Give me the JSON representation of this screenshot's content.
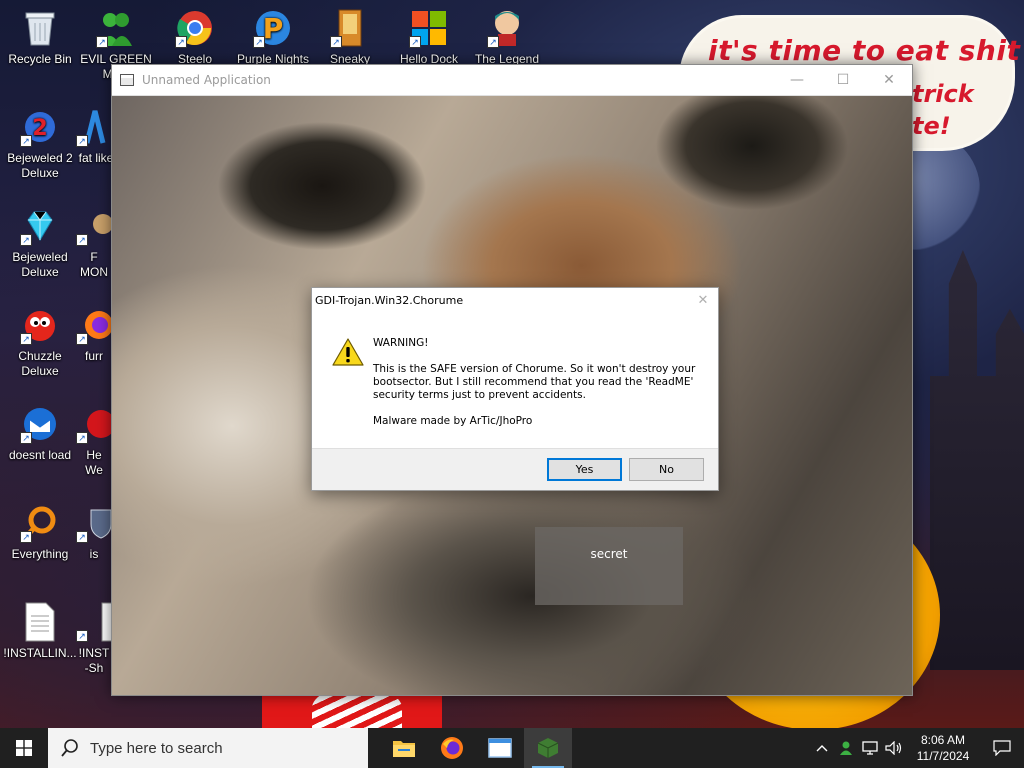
{
  "wallpaper": {
    "sign_line1": "it's time to eat shit",
    "sign_line2": "trick",
    "sign_line3": "te!"
  },
  "desktop_icons": [
    {
      "id": "recycle-bin",
      "label": "Recycle Bin",
      "icon": "recycle-bin-icon"
    },
    {
      "id": "evil-green",
      "label": "EVIL GREEN MEN",
      "icon": "green-men-icon"
    },
    {
      "id": "chrome",
      "label": "Steelo",
      "icon": "chrome-icon"
    },
    {
      "id": "purple-nights",
      "label": "Purple Nights",
      "icon": "p-logo-icon"
    },
    {
      "id": "sneaky",
      "label": "Sneaky",
      "icon": "game-icon"
    },
    {
      "id": "hello-dock",
      "label": "Hello Dock",
      "icon": "windows-logo-icon"
    },
    {
      "id": "the-legend",
      "label": "The Legend",
      "icon": "character-icon"
    },
    {
      "id": "bejeweled2",
      "label": "Bejeweled 2 Deluxe",
      "icon": "bejeweled2-icon"
    },
    {
      "id": "fat-like",
      "label": "fat like",
      "icon": "blue-figure-icon"
    },
    {
      "id": "bejeweled",
      "label": "Bejeweled Deluxe",
      "icon": "diamond-icon"
    },
    {
      "id": "fmon",
      "label": "F MON",
      "icon": "cartoon-icon"
    },
    {
      "id": "chuzzle",
      "label": "Chuzzle Deluxe",
      "icon": "chuzzle-icon"
    },
    {
      "id": "furr",
      "label": "furr",
      "icon": "firefox-icon"
    },
    {
      "id": "doesnt-load",
      "label": "doesnt load",
      "icon": "thunderbird-icon"
    },
    {
      "id": "he-we",
      "label": "He We",
      "icon": "red-ball-icon"
    },
    {
      "id": "everything",
      "label": "Everything",
      "icon": "search-ring-icon"
    },
    {
      "id": "is",
      "label": "is",
      "icon": "shield-icon"
    },
    {
      "id": "installing",
      "label": "!INSTALLIN...",
      "icon": "text-file-icon"
    },
    {
      "id": "installing2",
      "label": "!INST -Sh",
      "icon": "text-file-icon"
    }
  ],
  "app_window": {
    "title": "Unnamed Application",
    "minimize_glyph": "—",
    "maximize_glyph": "☐",
    "close_glyph": "✕",
    "secret_label": "secret"
  },
  "dialog": {
    "title": "GDI-Trojan.Win32.Chorume",
    "close_glyph": "✕",
    "line1": "WARNING!",
    "line2": "This is the SAFE version of Chorume. So it won't destroy your bootsector. But I still recommend that you read the 'ReadME' security terms just to prevent accidents.",
    "line3": "Malware made by ArTic/JhoPro",
    "yes_label": "Yes",
    "no_label": "No",
    "icon": "warning-icon"
  },
  "taskbar": {
    "search_placeholder": "Type here to search",
    "pinned": [
      "file-explorer-icon",
      "firefox-icon",
      "window-app-icon",
      "minecraft-icon"
    ],
    "clock_time": "8:06 AM",
    "clock_date": "11/7/2024"
  },
  "colors": {
    "sign_red": "#d7192d",
    "taskbar_bg": "#202020",
    "dialog_default_border": "#0078d7"
  }
}
